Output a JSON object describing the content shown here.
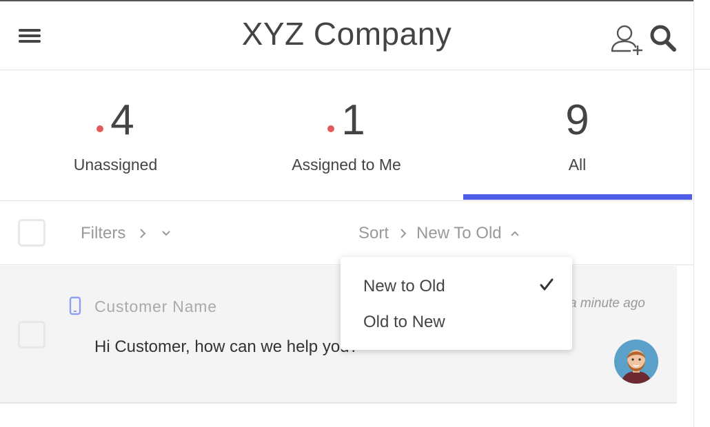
{
  "header": {
    "title": "XYZ Company",
    "menu_icon": "hamburger-menu-icon",
    "add_user_icon": "add-user-icon",
    "search_icon": "search-icon"
  },
  "tabs": [
    {
      "count": "4",
      "label": "Unassigned",
      "has_unread_dot": true,
      "active": false
    },
    {
      "count": "1",
      "label": "Assigned to Me",
      "has_unread_dot": true,
      "active": false
    },
    {
      "count": "9",
      "label": "All",
      "has_unread_dot": false,
      "active": true
    }
  ],
  "toolbar": {
    "filters_label": "Filters",
    "sort_label": "Sort",
    "sort_value": "New To Old"
  },
  "conversation": {
    "customer_name": "Customer Name",
    "timestamp": "a minute ago",
    "message": "Hi Customer, how can we help you?",
    "channel_icon": "mobile-phone-icon"
  },
  "sort_dropdown": {
    "options": [
      {
        "label": "New to Old",
        "selected": true
      },
      {
        "label": "Old to New",
        "selected": false
      }
    ]
  },
  "colors": {
    "accent": "#4f5ee8",
    "unread_dot": "#e15b5b",
    "text": "#444444",
    "muted": "#999999"
  }
}
